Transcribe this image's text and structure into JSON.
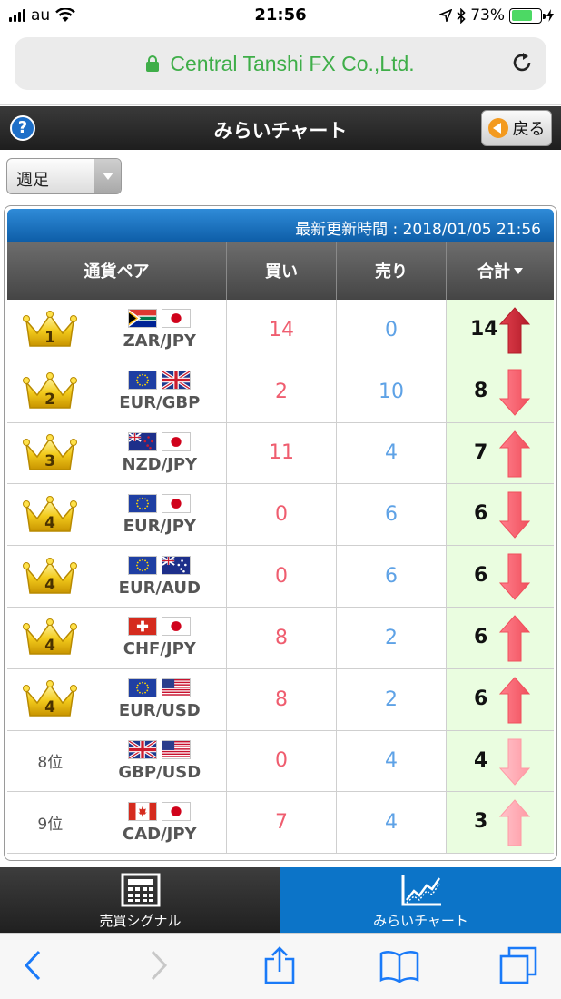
{
  "status_bar": {
    "carrier": "au",
    "time": "21:56",
    "battery": "73%",
    "battery_level": 0.73
  },
  "browser": {
    "url_text": "Central Tanshi FX Co.,Ltd."
  },
  "app_header": {
    "help_label": "?",
    "title": "みらいチャート",
    "back_label": "戻る"
  },
  "period_select": {
    "value": "週足"
  },
  "ranking": {
    "updated_label": "最新更新時間 : 2018/01/05 21:56",
    "columns": {
      "pair": "通貨ペア",
      "buy": "買い",
      "sell": "売り",
      "total": "合計"
    },
    "rows": [
      {
        "rank": 1,
        "rank_label": "1",
        "crown": true,
        "pair": "ZAR/JPY",
        "flags": [
          "za",
          "jp"
        ],
        "buy": "14",
        "sell": "0",
        "total": "14",
        "direction": "up",
        "intensity": "strong"
      },
      {
        "rank": 2,
        "rank_label": "2",
        "crown": true,
        "pair": "EUR/GBP",
        "flags": [
          "eu",
          "gb"
        ],
        "buy": "2",
        "sell": "10",
        "total": "8",
        "direction": "down",
        "intensity": "medium"
      },
      {
        "rank": 3,
        "rank_label": "3",
        "crown": true,
        "pair": "NZD/JPY",
        "flags": [
          "nz",
          "jp"
        ],
        "buy": "11",
        "sell": "4",
        "total": "7",
        "direction": "up",
        "intensity": "medium"
      },
      {
        "rank": 4,
        "rank_label": "4",
        "crown": true,
        "pair": "EUR/JPY",
        "flags": [
          "eu",
          "jp"
        ],
        "buy": "0",
        "sell": "6",
        "total": "6",
        "direction": "down",
        "intensity": "medium"
      },
      {
        "rank": 4,
        "rank_label": "4",
        "crown": true,
        "pair": "EUR/AUD",
        "flags": [
          "eu",
          "au"
        ],
        "buy": "0",
        "sell": "6",
        "total": "6",
        "direction": "down",
        "intensity": "medium"
      },
      {
        "rank": 4,
        "rank_label": "4",
        "crown": true,
        "pair": "CHF/JPY",
        "flags": [
          "ch",
          "jp"
        ],
        "buy": "8",
        "sell": "2",
        "total": "6",
        "direction": "up",
        "intensity": "medium"
      },
      {
        "rank": 4,
        "rank_label": "4",
        "crown": true,
        "pair": "EUR/USD",
        "flags": [
          "eu",
          "us"
        ],
        "buy": "8",
        "sell": "2",
        "total": "6",
        "direction": "up",
        "intensity": "medium"
      },
      {
        "rank": 8,
        "rank_label": "8位",
        "crown": false,
        "pair": "GBP/USD",
        "flags": [
          "gb",
          "us"
        ],
        "buy": "0",
        "sell": "4",
        "total": "4",
        "direction": "down",
        "intensity": "light"
      },
      {
        "rank": 9,
        "rank_label": "9位",
        "crown": false,
        "pair": "CAD/JPY",
        "flags": [
          "ca",
          "jp"
        ],
        "buy": "7",
        "sell": "4",
        "total": "3",
        "direction": "up",
        "intensity": "light"
      }
    ]
  },
  "tab_bar": {
    "tabs": [
      {
        "label": "売買シグナル",
        "icon": "calculator-icon",
        "active": false
      },
      {
        "label": "みらいチャート",
        "icon": "chart-icon",
        "active": true
      }
    ]
  },
  "colors": {
    "buy": "#ef5d6f",
    "sell": "#5ea2e6",
    "total_bg": "#eafde0",
    "url_green": "#3fae49",
    "active_tab": "#0c74c8"
  }
}
